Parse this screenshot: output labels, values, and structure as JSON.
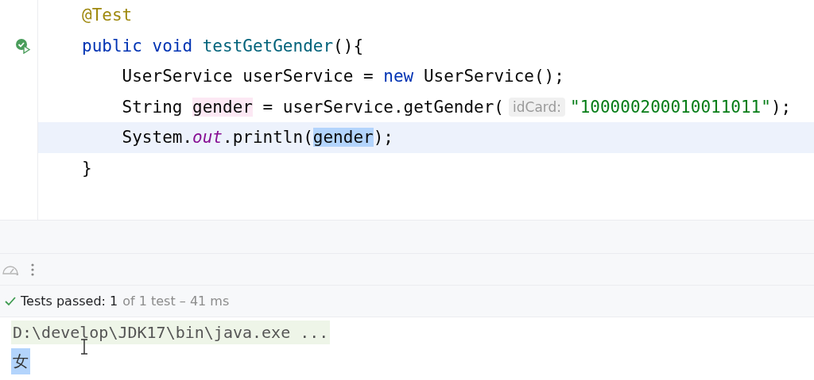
{
  "editor": {
    "lines": [
      {
        "current": false,
        "run_marker": false,
        "tokens": [
          {
            "kind": "annotation",
            "text": "@Test"
          }
        ]
      },
      {
        "current": false,
        "run_marker": true,
        "tokens": [
          {
            "kind": "keyword",
            "text": "public void "
          },
          {
            "kind": "method",
            "text": "testGetGender"
          },
          {
            "kind": "plain",
            "text": "(){"
          }
        ]
      },
      {
        "current": false,
        "run_marker": false,
        "tokens": [
          {
            "kind": "plain",
            "text": "    UserService userService = "
          },
          {
            "kind": "keyword",
            "text": "new"
          },
          {
            "kind": "plain",
            "text": " UserService();"
          }
        ]
      },
      {
        "current": false,
        "run_marker": false,
        "tokens": [
          {
            "kind": "plain",
            "text": "    String "
          },
          {
            "kind": "write",
            "text": "gender"
          },
          {
            "kind": "plain",
            "text": " = userService.getGender("
          },
          {
            "kind": "hint",
            "text": "idCard:"
          },
          {
            "kind": "string",
            "text": "\"100000200010011011\""
          },
          {
            "kind": "plain",
            "text": ");"
          }
        ]
      },
      {
        "current": true,
        "run_marker": false,
        "tokens": [
          {
            "kind": "plain",
            "text": "    System."
          },
          {
            "kind": "static",
            "text": "out"
          },
          {
            "kind": "plain",
            "text": ".println("
          },
          {
            "kind": "read",
            "text": "gender"
          },
          {
            "kind": "plain",
            "text": ");"
          }
        ]
      },
      {
        "current": false,
        "run_marker": false,
        "tokens": [
          {
            "kind": "plain",
            "text": "}"
          }
        ]
      }
    ]
  },
  "run_panel": {
    "status": {
      "passed": true,
      "label": "Tests passed: 1",
      "detail": "of 1 test – 41 ms"
    },
    "console": [
      {
        "kind": "command",
        "text": "D:\\develop\\JDK17\\bin\\java.exe ...",
        "selected": false
      },
      {
        "kind": "output",
        "text": "女",
        "selected": true
      }
    ]
  }
}
